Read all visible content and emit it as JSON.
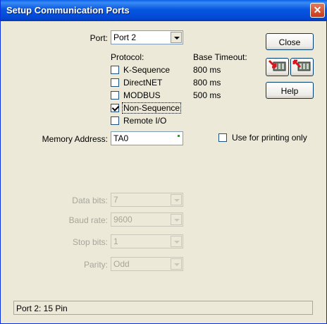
{
  "window": {
    "title": "Setup Communication Ports",
    "close_glyph": "✕"
  },
  "port": {
    "label": "Port:",
    "value": "Port 2"
  },
  "protocol": {
    "label": "Protocol:",
    "timeout_label": "Base Timeout:",
    "options": [
      {
        "label": "K-Sequence",
        "checked": false,
        "timeout": "800 ms"
      },
      {
        "label": "DirectNET",
        "checked": false,
        "timeout": "800 ms"
      },
      {
        "label": "MODBUS",
        "checked": false,
        "timeout": "500 ms"
      },
      {
        "label": "Non-Sequence",
        "checked": true,
        "timeout": ""
      },
      {
        "label": "Remote I/O",
        "checked": false,
        "timeout": ""
      }
    ]
  },
  "memory": {
    "label": "Memory Address:",
    "value": "TA0"
  },
  "print_only": {
    "label": "Use for printing only",
    "checked": false
  },
  "buttons": {
    "close": "Close",
    "help": "Help",
    "upload_icon": "upload-to-plc-icon",
    "download_icon": "download-from-plc-icon"
  },
  "serial": {
    "data_bits": {
      "label": "Data bits:",
      "value": "7"
    },
    "baud_rate": {
      "label": "Baud rate:",
      "value": "9600"
    },
    "stop_bits": {
      "label": "Stop bits:",
      "value": "1"
    },
    "parity": {
      "label": "Parity:",
      "value": "Odd"
    }
  },
  "status": {
    "text": "Port 2: 15 Pin"
  },
  "colors": {
    "title_bar": "#0449D4",
    "face": "#ECE9D8",
    "disabled_text": "#A7A69A"
  }
}
